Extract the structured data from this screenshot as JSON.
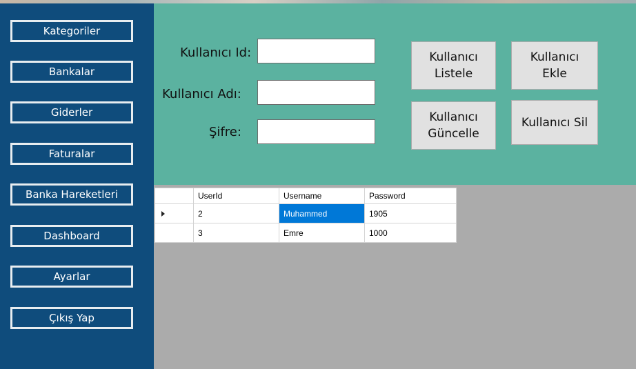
{
  "sidebar": {
    "items": [
      {
        "label": "Kategoriler"
      },
      {
        "label": "Bankalar"
      },
      {
        "label": "Giderler"
      },
      {
        "label": "Faturalar"
      },
      {
        "label": "Banka Hareketleri"
      },
      {
        "label": "Dashboard"
      },
      {
        "label": "Ayarlar"
      },
      {
        "label": "Çıkış Yap"
      }
    ]
  },
  "form": {
    "id_label": "Kullanıcı Id:",
    "id_value": "",
    "name_label": "Kullanıcı Adı:",
    "name_value": "",
    "password_label": "Şifre:",
    "password_value": ""
  },
  "actions": {
    "list_line1": "Kullanıcı",
    "list_line2": "Listele",
    "add_line1": "Kullanıcı",
    "add_line2": "Ekle",
    "update_line1": "Kullanıcı",
    "update_line2": "Güncelle",
    "delete_label": "Kullanıcı Sil"
  },
  "grid": {
    "columns": [
      "UserId",
      "Username",
      "Password"
    ],
    "rows": [
      {
        "userid": "2",
        "username": "Muhammed",
        "password": "1905",
        "selected": true
      },
      {
        "userid": "3",
        "username": "Emre",
        "password": "1000",
        "selected": false
      }
    ]
  },
  "colors": {
    "sidebar": "#0f4c7c",
    "top_panel": "#5bb2a0",
    "grid_background": "#ababab",
    "selection": "#0078d7"
  }
}
